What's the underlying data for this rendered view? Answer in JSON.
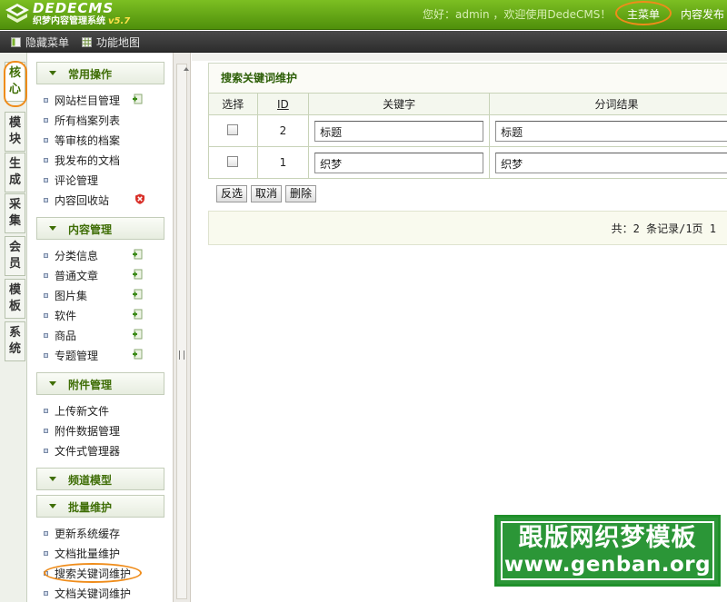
{
  "header": {
    "logo_main": "DEDECMS",
    "logo_sub": "织梦内容管理系统",
    "logo_version": "v5.7",
    "welcome": "您好：admin ，欢迎使用DedeCMS！",
    "menu_main": "主菜单",
    "menu_content": "内容发布",
    "bg_color": "#5a9a10"
  },
  "toolbar": {
    "hide_menu": "隐藏菜单",
    "function_map": "功能地图"
  },
  "vtabs": [
    {
      "label": "核心",
      "active": true
    },
    {
      "label": "模块"
    },
    {
      "label": "生成"
    },
    {
      "label": "采集"
    },
    {
      "label": "会员"
    },
    {
      "label": "模板"
    },
    {
      "label": "系统"
    }
  ],
  "menu": {
    "common": {
      "title": "常用操作",
      "items": [
        "网站栏目管理",
        "所有档案列表",
        "等审核的档案",
        "我发布的文档",
        "评论管理",
        "内容回收站"
      ]
    },
    "content": {
      "title": "内容管理",
      "items": [
        "分类信息",
        "普通文章",
        "图片集",
        "软件",
        "商品",
        "专题管理"
      ]
    },
    "attach": {
      "title": "附件管理",
      "items": [
        "上传新文件",
        "附件数据管理",
        "文件式管理器"
      ]
    },
    "channel": {
      "title": "频道模型"
    },
    "batch": {
      "title": "批量维护",
      "items": [
        "更新系统缓存",
        "文档批量维护",
        "搜索关键词维护",
        "文档关键词维护"
      ]
    }
  },
  "main": {
    "title": "搜索关键词维护",
    "columns": [
      "选择",
      "ID",
      "关键字",
      "分词结果"
    ],
    "rows": [
      {
        "id": "2",
        "keyword": "标题",
        "segment": "标题"
      },
      {
        "id": "1",
        "keyword": "织梦",
        "segment": "织梦"
      }
    ],
    "buttons": {
      "invert": "反选",
      "cancel": "取消",
      "delete": "删除"
    },
    "summary": "共：2 条记录/1页 1"
  },
  "watermark": {
    "line1": "跟版网织梦模板",
    "line2": "www.genban.org"
  }
}
